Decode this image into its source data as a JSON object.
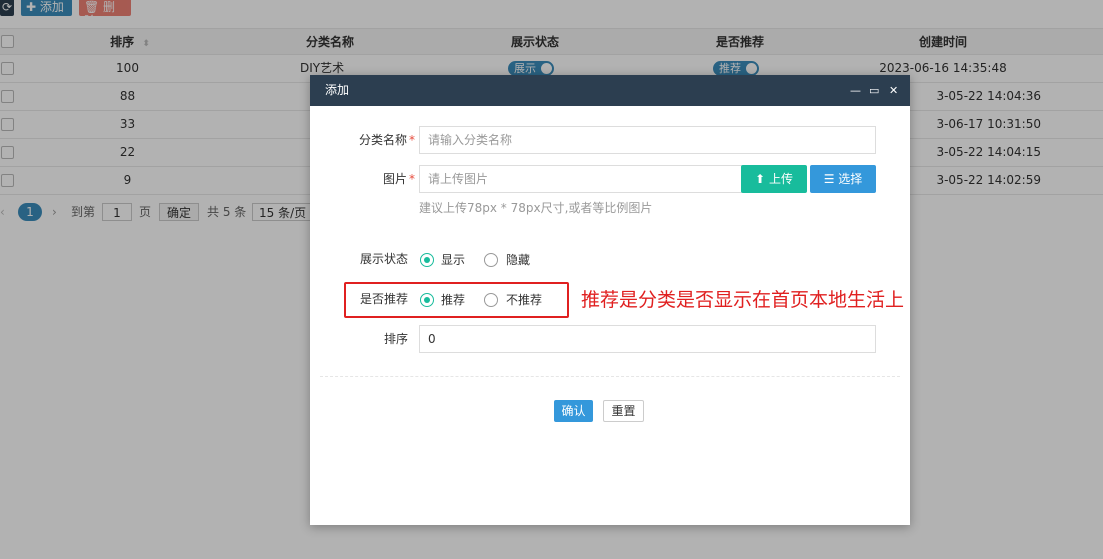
{
  "toolbar": {
    "refresh_icon": "refresh-icon",
    "add_label": "✚ 添加",
    "delete_label": "🗑 删除"
  },
  "table": {
    "columns": [
      "排序",
      "分类名称",
      "展示状态",
      "是否推荐",
      "创建时间"
    ],
    "sort_icon": "⬍",
    "rows": [
      {
        "sort": "100",
        "name": "DIY艺术",
        "status": "展示",
        "recommend": "推荐",
        "created": "2023-06-16 14:35:48"
      },
      {
        "sort": "88",
        "name": "",
        "status": "",
        "recommend": "",
        "created": "3-05-22 14:04:36"
      },
      {
        "sort": "33",
        "name": "",
        "status": "",
        "recommend": "",
        "created": "3-06-17 10:31:50"
      },
      {
        "sort": "22",
        "name": "",
        "status": "",
        "recommend": "",
        "created": "3-05-22 14:04:15"
      },
      {
        "sort": "9",
        "name": "",
        "status": "",
        "recommend": "",
        "created": "3-05-22 14:02:59"
      }
    ]
  },
  "pager": {
    "prev": "‹",
    "current": "1",
    "next": "›",
    "goto_label": "到第",
    "page_value": "1",
    "page_unit": "页",
    "confirm": "确定",
    "total": "共 5 条",
    "per_page": "15 条/页"
  },
  "modal": {
    "title": "添加",
    "minimize": "—",
    "maximize": "▭",
    "close": "✕",
    "name_label": "分类名称",
    "name_placeholder": "请输入分类名称",
    "image_label": "图片",
    "image_placeholder": "请上传图片",
    "upload_label": "上传",
    "select_label": "选择",
    "image_hint": "建议上传78px * 78px尺寸,或者等比例图片",
    "status_label": "展示状态",
    "status_options": [
      "显示",
      "隐藏"
    ],
    "recommend_label": "是否推荐",
    "recommend_options": [
      "推荐",
      "不推荐"
    ],
    "sort_label": "排序",
    "sort_value": "0",
    "confirm_label": "确认",
    "reset_label": "重置",
    "required_mark": "*"
  },
  "annotation": {
    "text": "推荐是分类是否显示在首页本地生活上"
  },
  "colors": {
    "header_bg": "#2c3e50",
    "primary": "#3c8dbc",
    "success": "#18bc9c",
    "danger": "#e74c3c",
    "annotation": "#e02020"
  }
}
